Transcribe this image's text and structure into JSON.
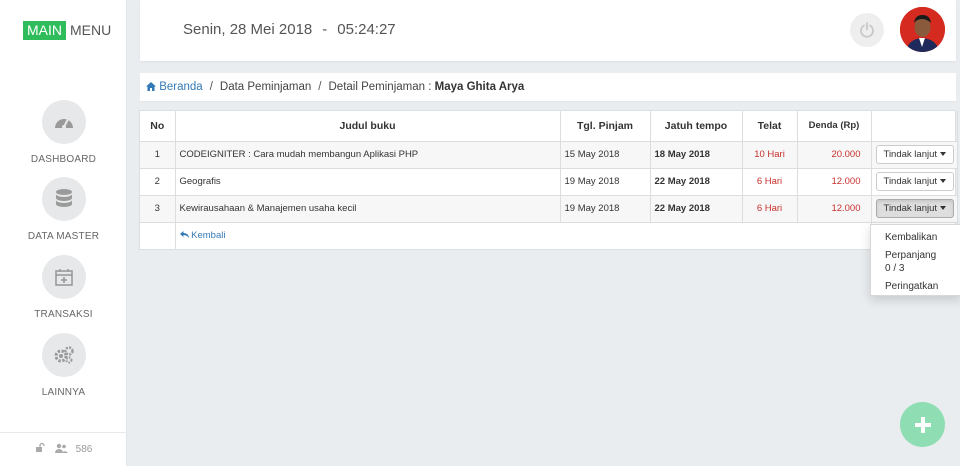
{
  "brand": {
    "main": "MAIN",
    "menu": "MENU"
  },
  "sidebar": {
    "items": [
      {
        "label": "DASHBOARD",
        "icon": "dashboard-icon"
      },
      {
        "label": "DATA MASTER",
        "icon": "database-icon"
      },
      {
        "label": "TRANSAKSI",
        "icon": "calendar-plus-icon"
      },
      {
        "label": "LAINNYA",
        "icon": "gears-icon"
      }
    ],
    "footer_count": "586"
  },
  "header": {
    "date": "Senin, 28 Mei 2018",
    "separator": "-",
    "time": "05:24:27"
  },
  "breadcrumb": {
    "home": "Beranda",
    "divider": "/",
    "level2": "Data Peminjaman",
    "level3_prefix": "Detail Peminjaman :",
    "level3_name": "Maya Ghita Arya"
  },
  "table": {
    "headers": [
      "No",
      "Judul buku",
      "Tgl. Pinjam",
      "Jatuh tempo",
      "Telat",
      "Denda (Rp)",
      ""
    ],
    "rows": [
      {
        "no": "1",
        "judul": "CODEIGNITER : Cara mudah membangun Aplikasi PHP",
        "tgl_pinjam": "15 May 2018",
        "jatuh_tempo": "18 May 2018",
        "telat": "10 Hari",
        "denda": "20.000",
        "action": "Tindak lanjut"
      },
      {
        "no": "2",
        "judul": "Geografis",
        "tgl_pinjam": "19 May 2018",
        "jatuh_tempo": "22 May 2018",
        "telat": "6 Hari",
        "denda": "12.000",
        "action": "Tindak lanjut"
      },
      {
        "no": "3",
        "judul": "Kewirausahaan & Manajemen usaha kecil",
        "tgl_pinjam": "19 May 2018",
        "jatuh_tempo": "22 May 2018",
        "telat": "6 Hari",
        "denda": "12.000",
        "action": "Tindak lanjut"
      }
    ],
    "back_label": "Kembali"
  },
  "dropdown": {
    "kembalikan": "Kembalikan",
    "perpanjang": "Perpanjang",
    "perpanjang_count": "0 / 3",
    "peringatkan": "Peringatkan"
  },
  "colors": {
    "brand_green": "#2ebd5a",
    "late_red": "#c9302c",
    "link_blue": "#337ab7",
    "fab_green": "#8fddb2"
  }
}
